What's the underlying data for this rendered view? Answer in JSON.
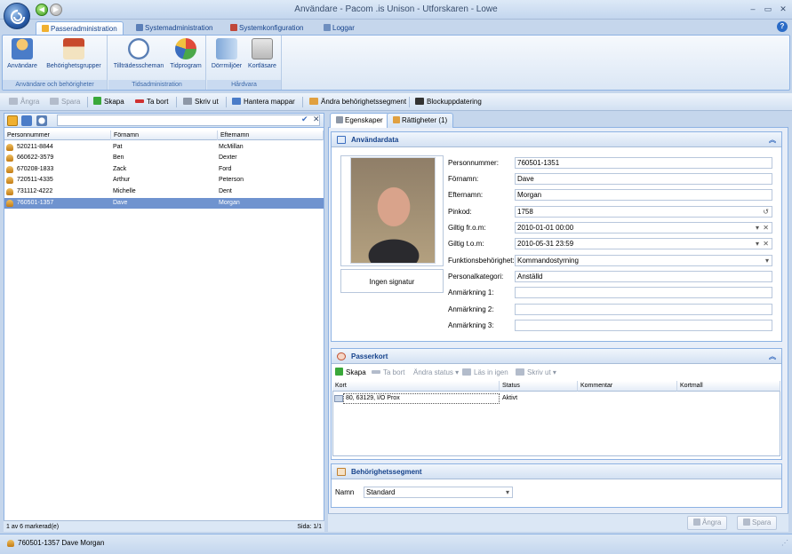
{
  "window": {
    "title": "Användare - Pacom .is Unison - Utforskaren - Lowe"
  },
  "ribbon_tabs": [
    {
      "label": "Passeradministration"
    },
    {
      "label": "Systemadministration"
    },
    {
      "label": "Systemkonfiguration"
    },
    {
      "label": "Loggar"
    }
  ],
  "ribbon_groups": [
    {
      "label": "Användare och behörigheter",
      "buttons": [
        "Användare",
        "Behörighetsgrupper"
      ]
    },
    {
      "label": "Tidsadministration",
      "buttons": [
        "Tillträdesscheman",
        "Tidprogram"
      ]
    },
    {
      "label": "Hårdvara",
      "buttons": [
        "Dörrmiljöer",
        "Kortläsare"
      ]
    }
  ],
  "toolbar": {
    "undo": "Ångra",
    "save": "Spara",
    "create": "Skapa",
    "delete": "Ta bort",
    "print": "Skriv ut",
    "manage_folders": "Hantera mappar",
    "change_segments": "Ändra behörighetssegment",
    "block_update": "Blockuppdatering"
  },
  "grid": {
    "columns": [
      "Personnummer",
      "Förnamn",
      "Efternamn"
    ],
    "rows": [
      [
        "520211-8844",
        "Pat",
        "McMillan"
      ],
      [
        "660622-3579",
        "Ben",
        "Dexter"
      ],
      [
        "670208-1833",
        "Zack",
        "Ford"
      ],
      [
        "720511-4335",
        "Arthur",
        "Peterson"
      ],
      [
        "731112-4222",
        "Michelle",
        "Dent"
      ],
      [
        "760501-1357",
        "Dave",
        "Morgan"
      ]
    ],
    "status_left": "1 av 6 markerad(e)",
    "status_right": "Sida: 1/1"
  },
  "detail_tabs": [
    {
      "label": "Egenskaper"
    },
    {
      "label": "Rättigheter (1)"
    }
  ],
  "userdata": {
    "heading": "Användardata",
    "signature": "Ingen signatur",
    "fields": [
      {
        "label": "Personnummer:",
        "value": "760501-1351"
      },
      {
        "label": "Förnamn:",
        "value": "Dave"
      },
      {
        "label": "Efternamn:",
        "value": "Morgan"
      },
      {
        "label": "Pinkod:",
        "value": "1758"
      },
      {
        "label": "Giltig fr.o.m:",
        "value": "2010-01-01 00:00"
      },
      {
        "label": "Giltig t.o.m:",
        "value": "2010-05-31 23:59"
      },
      {
        "label": "Funktionsbehörighet:",
        "value": "Kommandostyrning"
      },
      {
        "label": "Personalkategori:",
        "value": "Anställd"
      },
      {
        "label": "Anmärkning 1:",
        "value": ""
      },
      {
        "label": "Anmärkning 2:",
        "value": ""
      },
      {
        "label": "Anmärkning 3:",
        "value": ""
      }
    ]
  },
  "passerkort": {
    "heading": "Passerkort",
    "toolbar": {
      "create": "Skapa",
      "delete": "Ta bort",
      "change_status": "Ändra status",
      "read_in": "Läs in igen",
      "print": "Skriv ut"
    },
    "columns": [
      "Kort",
      "Status",
      "Kommentar",
      "Kortmall"
    ],
    "rows": [
      [
        "80, 63129, I/O Prox",
        "Aktivt",
        "",
        ""
      ]
    ]
  },
  "segment": {
    "heading": "Behörighetssegment",
    "name_label": "Namn",
    "name_value": "Standard"
  },
  "bottom_buttons": {
    "undo": "Ångra",
    "save": "Spara"
  },
  "statusbar": {
    "user": "760501-1357 Dave Morgan"
  }
}
